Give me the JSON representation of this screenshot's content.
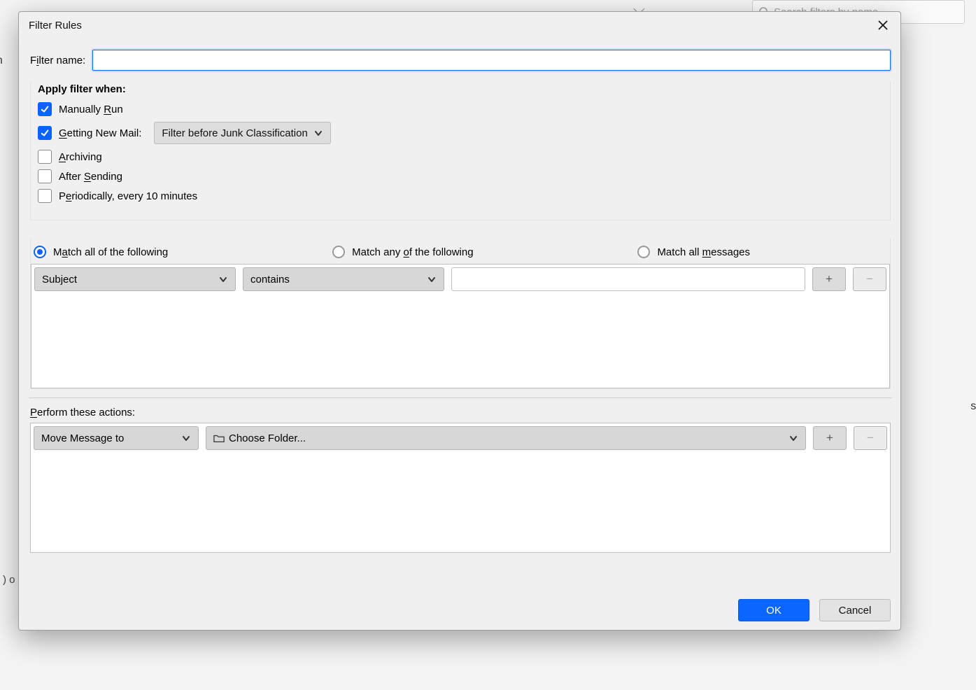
{
  "underlay": {
    "search_placeholder": "Search filters by name",
    "caret_glyph": "⌵",
    "left_fragment": "un",
    "right_fragment": "se t",
    "q_fragment": ") o"
  },
  "dialog": {
    "title": "Filter Rules",
    "filter_name_label": "Filter name:",
    "filter_name_value": "",
    "apply_when_title": "Apply filter when:",
    "when": {
      "manual_run": {
        "checked": true,
        "label_pre": "Manually ",
        "mnemonic": "R",
        "label_suf": "un"
      },
      "getting_new_mail": {
        "checked": true,
        "mnemonic": "G",
        "label_suf": "etting New Mail:",
        "classification_options_selected": "Filter before Junk Classification"
      },
      "archiving": {
        "checked": false,
        "mnemonic": "A",
        "label_suf": "rchiving"
      },
      "after_sending": {
        "checked": false,
        "label_pre": "After ",
        "mnemonic": "S",
        "label_suf": "ending"
      },
      "periodically": {
        "checked": false,
        "label_pre": "P",
        "mnemonic": "e",
        "label_suf": "riodically, every 10 minutes"
      }
    },
    "match": {
      "mode": "all",
      "all": {
        "label_pre": "M",
        "mnemonic": "a",
        "label_suf": "tch all of the following"
      },
      "any": {
        "label_pre": "Match any ",
        "mnemonic": "o",
        "label_suf": "f the following"
      },
      "msgs": {
        "label_pre": "Match all ",
        "mnemonic": "m",
        "label_suf": "essages"
      }
    },
    "condition_field": "Subject",
    "condition_op": "contains",
    "condition_value": "",
    "actions_label_pre": "",
    "actions_mnemonic": "P",
    "actions_label_suf": "erform these actions:",
    "action_type": "Move Message to",
    "action_target": "Choose Folder...",
    "ok_label": "OK",
    "cancel_label": "Cancel",
    "plus": "+",
    "minus": "−"
  }
}
